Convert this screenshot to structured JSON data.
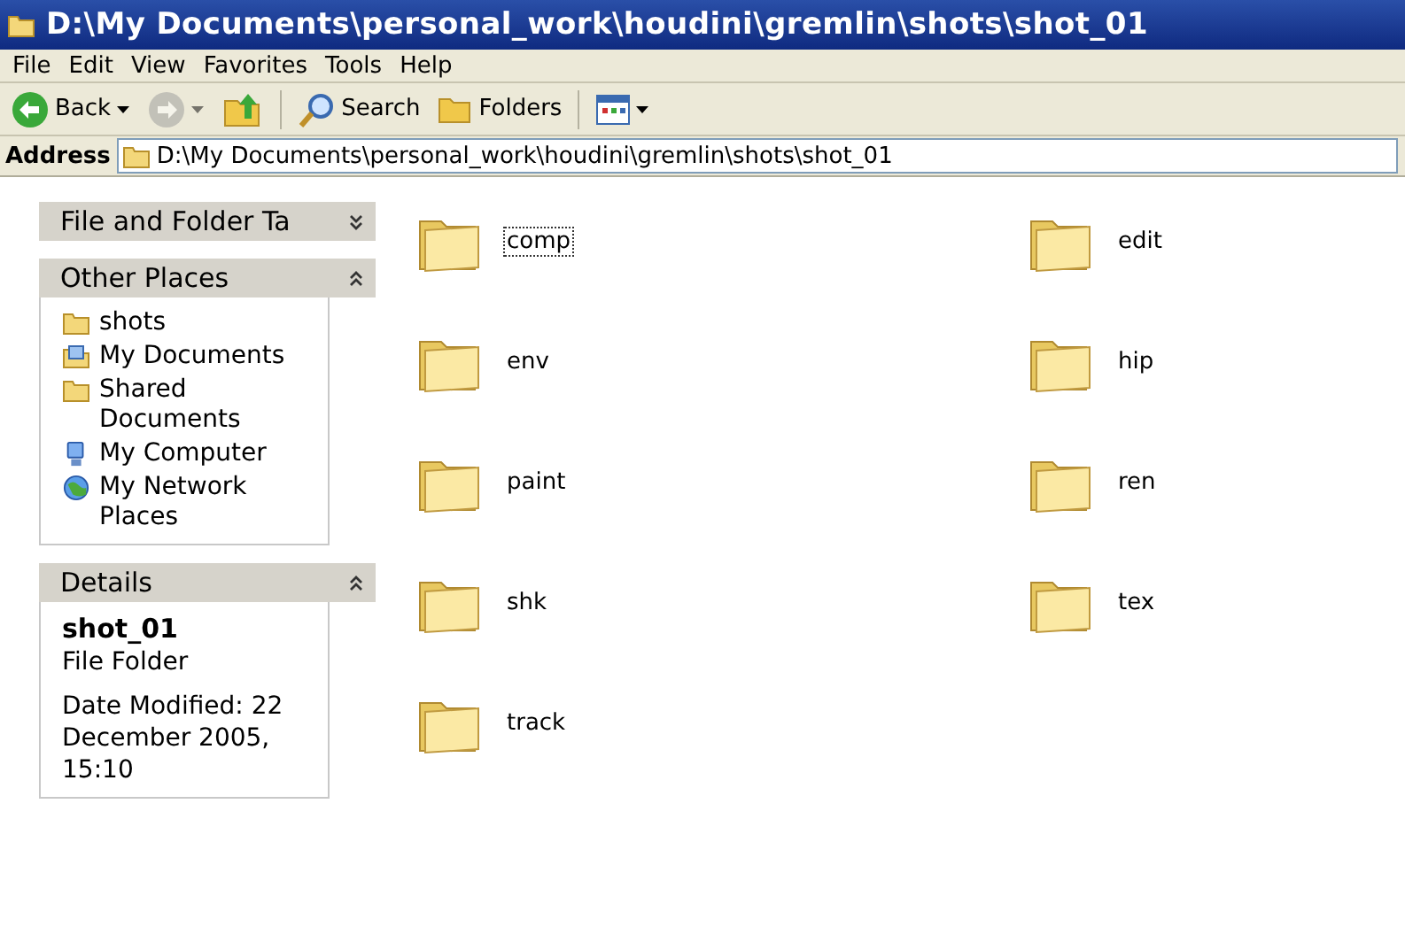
{
  "window": {
    "title": "D:\\My Documents\\personal_work\\houdini\\gremlin\\shots\\shot_01"
  },
  "menu": [
    "File",
    "Edit",
    "View",
    "Favorites",
    "Tools",
    "Help"
  ],
  "toolbar": [
    {
      "kind": "back",
      "label": "Back",
      "disabled": false
    },
    {
      "kind": "forward",
      "disabled": true
    },
    {
      "kind": "up",
      "disabled": false
    },
    {
      "kind": "search",
      "label": "Search",
      "disabled": false
    },
    {
      "kind": "folders",
      "label": "Folders",
      "disabled": false
    },
    {
      "kind": "views",
      "disabled": false
    }
  ],
  "address": {
    "label": "Address",
    "value": "D:\\My Documents\\personal_work\\houdini\\gremlin\\shots\\shot_01"
  },
  "sidebar": [
    {
      "title": "File and Folder Ta",
      "expanded": false
    },
    {
      "title": "Other Places",
      "expanded": true,
      "items": [
        {
          "kind": "folder",
          "label": "shots"
        },
        {
          "kind": "documents",
          "label": "My Documents"
        },
        {
          "kind": "folder",
          "label": "Shared Documents"
        },
        {
          "kind": "computer",
          "label": "My Computer"
        },
        {
          "kind": "network",
          "label": "My Network Places"
        }
      ]
    },
    {
      "title": "Details",
      "expanded": true,
      "details": {
        "name": "shot_01",
        "type": "File Folder",
        "info": "Date Modified: 22 December 2005, 15:10"
      }
    }
  ],
  "folders": [
    {
      "name": "comp",
      "focused": true
    },
    {
      "name": "edit",
      "focused": false
    },
    {
      "name": "env",
      "focused": false
    },
    {
      "name": "hip",
      "focused": false
    },
    {
      "name": "paint",
      "focused": false
    },
    {
      "name": "ren",
      "focused": false
    },
    {
      "name": "shk",
      "focused": false
    },
    {
      "name": "tex",
      "focused": false
    },
    {
      "name": "track",
      "focused": false
    }
  ]
}
